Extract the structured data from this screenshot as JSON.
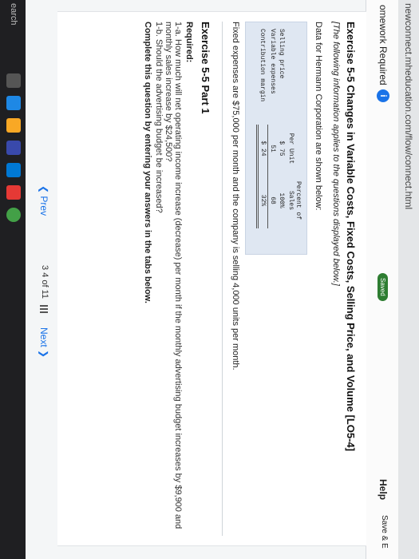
{
  "browser": {
    "url": "newconnect.mheducation.com/flow/connect.html"
  },
  "header": {
    "title": "omework Required",
    "info": "i",
    "saved": "Saved",
    "help": "Help",
    "save_exit": "Save & E"
  },
  "exercise": {
    "title": "Exercise 5-5 Changes in Variable Costs, Fixed Costs, Selling Price, and Volume [LO5-4]",
    "note": "[The following information applies to the questions displayed below.]",
    "intro": "Data for Hermann Corporation are shown below:",
    "table": {
      "col_per_unit": "Per Unit",
      "col_percent": "Percent of Sales",
      "rows": [
        {
          "label": "Selling price",
          "per_unit": "$ 75",
          "percent": "100%"
        },
        {
          "label": "Variable expenses",
          "per_unit": "51",
          "percent": "68"
        },
        {
          "label": "Contribution margin",
          "per_unit": "$ 24",
          "percent": "32%"
        }
      ]
    },
    "fixed": "Fixed expenses are $75,000 per month and the company is selling 4,000 units per month."
  },
  "part": {
    "title": "Exercise 5-5 Part 1",
    "required_label": "Required:",
    "req_1a_line1": "1-a. How much will net operating income increase (decrease) per month if the monthly advertising budget increases by $9,900 and",
    "req_1a_line2": "monthly sales increase by $24,500?",
    "req_1b": "1-b. Should the advertising budget be increased?",
    "complete": "Complete this question by entering your answers in the tabs below."
  },
  "nav": {
    "prev": "Prev",
    "current": "3",
    "next_page": "4",
    "of": "of 11",
    "next": "Next"
  },
  "taskbar": {
    "search": "earch"
  },
  "colors": {
    "accent": "#1a73e8",
    "saved": "#2e7d32",
    "table_bg": "#dfe7f2"
  }
}
